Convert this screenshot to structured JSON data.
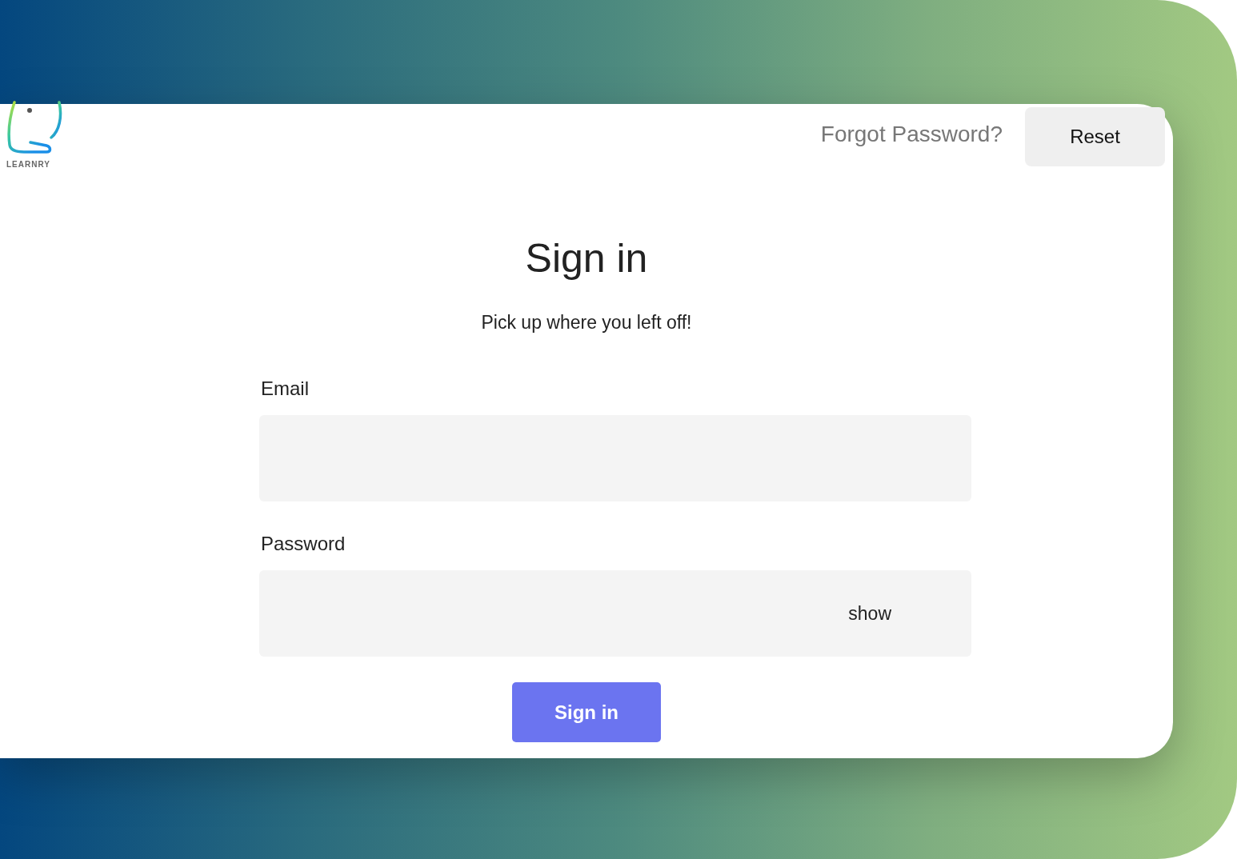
{
  "logo": {
    "text": "LEARNRY"
  },
  "header": {
    "prompt": "Forgot Password?",
    "reset_button": "Reset"
  },
  "title": "Sign in",
  "subtitle": "Pick up where you left off!",
  "fields": [
    {
      "label": "Email"
    },
    {
      "label": "Password",
      "toggle": "show"
    }
  ],
  "submit_button": "Sign in"
}
